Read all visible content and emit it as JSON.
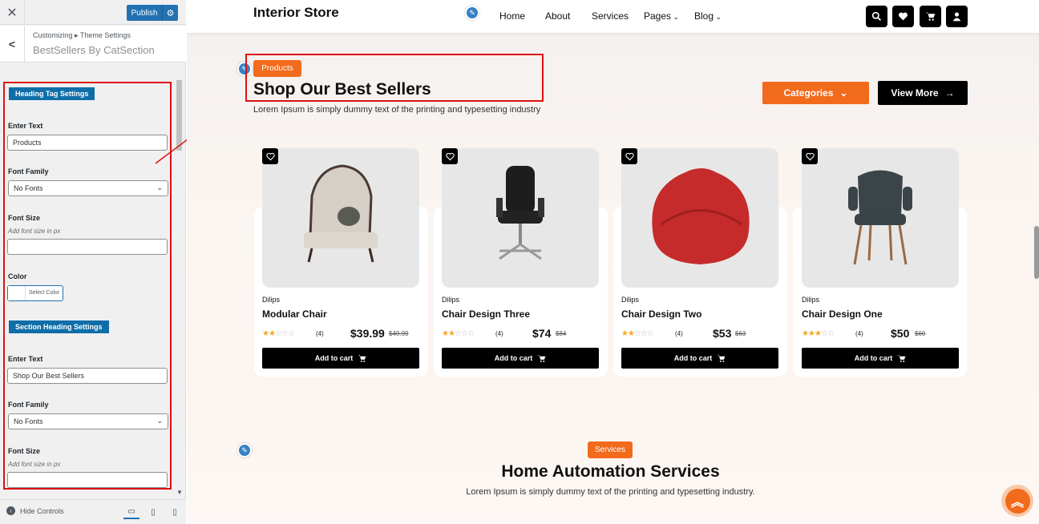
{
  "customizer": {
    "close_icon": "✕",
    "publish_label": "Publish",
    "breadcrumb": "Customizing ▸ Theme Settings",
    "section_title": "BestSellers By CatSection",
    "heading_tag_group": "Heading Tag Settings",
    "section_heading_group": "Section Heading Settings",
    "labels": {
      "enter_text": "Enter Text",
      "font_family": "Font Family",
      "font_size": "Font Size",
      "font_size_hint": "Add font size in px",
      "color": "Color",
      "select_color": "Select Color"
    },
    "heading_tag": {
      "text_value": "Products",
      "font_family": "No Fonts",
      "font_size": ""
    },
    "section_heading": {
      "text_value": "Shop Our Best Sellers",
      "font_family": "No Fonts",
      "font_size": ""
    },
    "hide_controls": "Hide Controls",
    "accent_color": "#2271b1"
  },
  "site": {
    "logo": "Interior Store",
    "nav": [
      "Home",
      "About",
      "Services",
      "Pages",
      "Blog"
    ],
    "products_badge": "Products",
    "heading": "Shop Our Best Sellers",
    "subheading": "Lorem Ipsum is simply dummy text of the printing and typesetting industry",
    "categories_button": "Categories",
    "view_more_button": "View More",
    "products": [
      {
        "brand": "Dilips",
        "name": "Modular Chair",
        "rating": 2,
        "count": "(4)",
        "price": "$39.99",
        "old_price": "$49.99",
        "cart": "Add to cart"
      },
      {
        "brand": "Dilips",
        "name": "Chair Design Three",
        "rating": 2,
        "count": "(4)",
        "price": "$74",
        "old_price": "$84",
        "cart": "Add to cart"
      },
      {
        "brand": "Dilips",
        "name": "Chair Design Two",
        "rating": 2,
        "count": "(4)",
        "price": "$53",
        "old_price": "$63",
        "cart": "Add to cart"
      },
      {
        "brand": "Dilips",
        "name": "Chair Design One",
        "rating": 3,
        "count": "(4)",
        "price": "$50",
        "old_price": "$60",
        "cart": "Add to cart"
      }
    ],
    "services_badge": "Services",
    "services_title": "Home Automation Services",
    "services_sub": "Lorem Ipsum is simply dummy text of the printing and typesetting industry.",
    "accent_color": "#f26a1b"
  }
}
